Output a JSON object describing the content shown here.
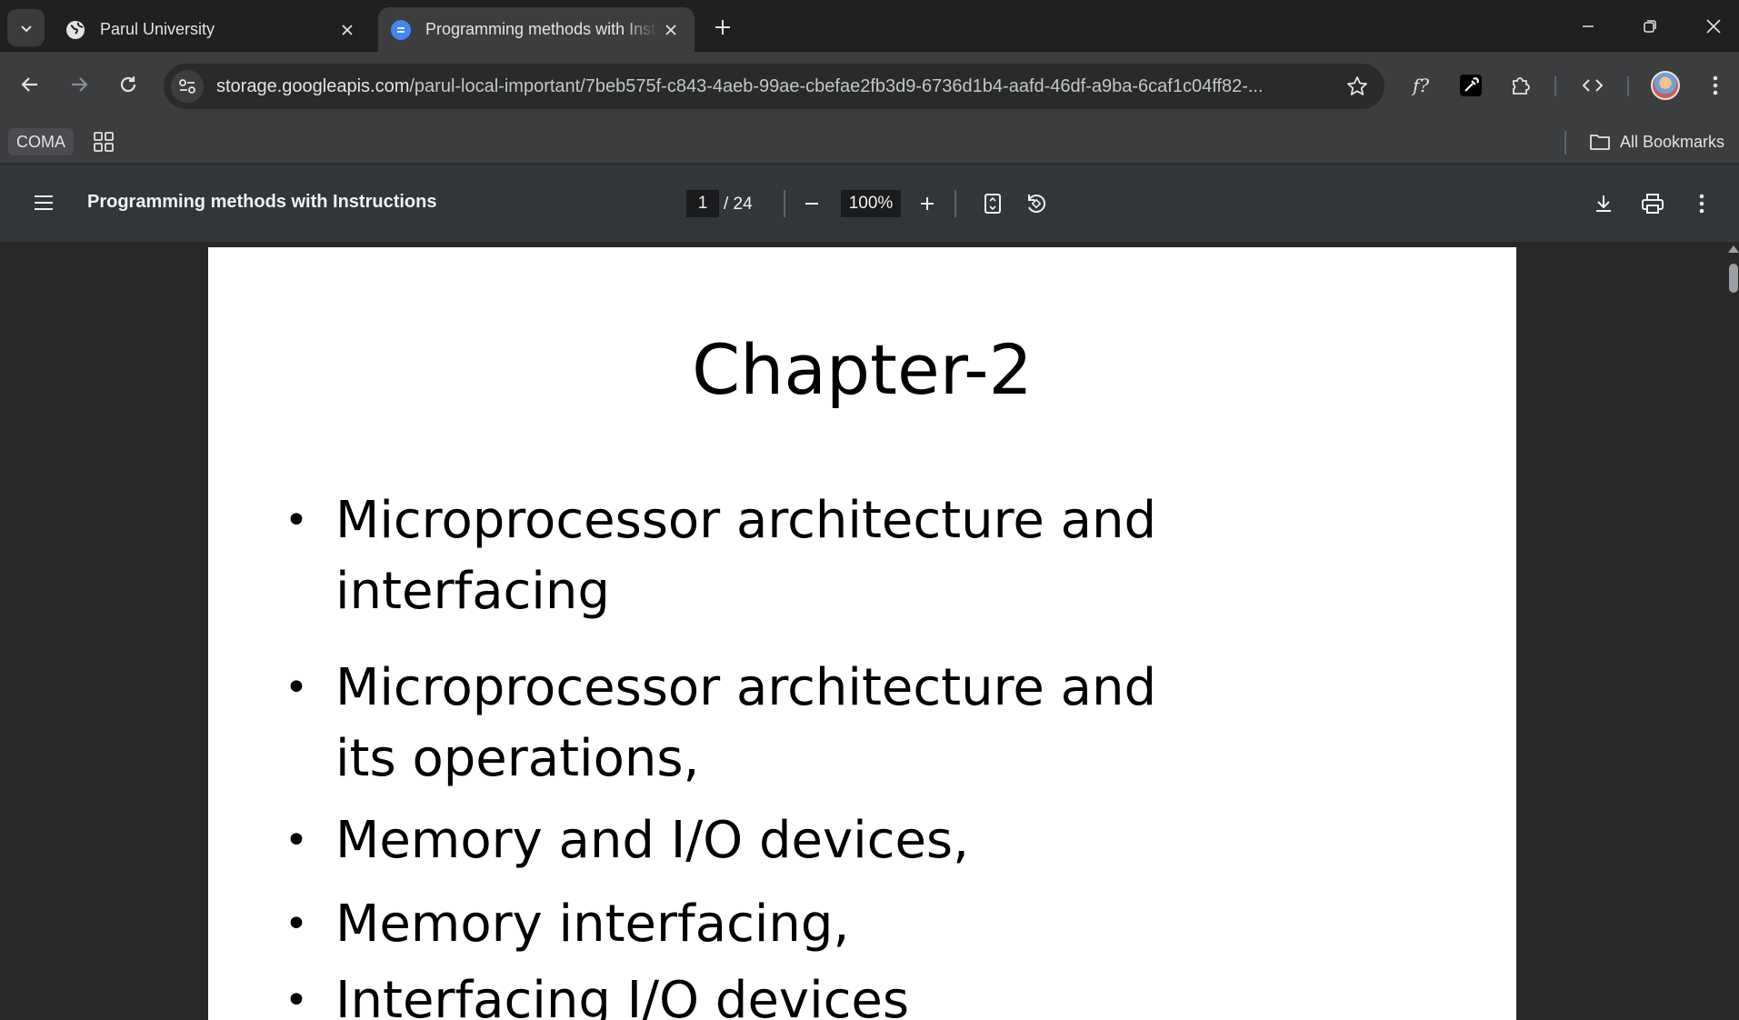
{
  "browser": {
    "tabs": [
      {
        "title": "Parul University",
        "favicon": "globe-icon",
        "active": false
      },
      {
        "title": "Programming methods with Instructions",
        "favicon": "docs-icon",
        "active": true
      }
    ],
    "url_host": "storage.googleapis.com",
    "url_path": "/parul-local-important/7beb575f-c843-4aeb-99ae-cbefae2fb3d9-6736d1b4-aafd-46df-a9ba-6caf1c04ff82-...",
    "bookmarks": {
      "coma_label": "COMA",
      "all_bookmarks_label": "All Bookmarks"
    }
  },
  "pdf_viewer": {
    "title": "Programming methods with Instructions",
    "current_page": "1",
    "total_pages": "/ 24",
    "zoom": "100%"
  },
  "document": {
    "heading": "Chapter-2",
    "bullets": [
      "Microprocessor architecture and interfacing",
      "Microprocessor architecture and its operations,",
      "Memory and I/O devices,",
      "Memory interfacing,",
      "Interfacing I/O devices"
    ]
  },
  "colors": {
    "tab_strip": "#1f2020",
    "toolbar": "#3c3d3f",
    "pdf_toolbar": "#323639",
    "doc_background": "#282828",
    "docs_accent": "#4285f4"
  }
}
